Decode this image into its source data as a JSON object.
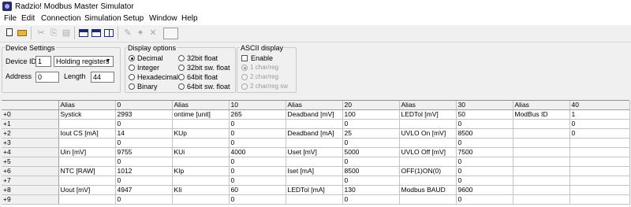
{
  "window": {
    "title": "Radzio! Modbus Master Simulator",
    "icon": "app-icon"
  },
  "menu": [
    "File",
    "Edit",
    "Connection",
    "Simulation",
    "Setup",
    "Window",
    "Help"
  ],
  "toolbar": {
    "icons": [
      "new-icon",
      "open-icon",
      "cut-icon",
      "copy-icon",
      "paste-icon",
      "cascade-icon",
      "tile-horizontal-icon",
      "tile-vertical-icon",
      "connect-icon",
      "disconnect-icon",
      "close-icon"
    ]
  },
  "device_settings": {
    "title": "Device Settings",
    "device_id_label": "Device ID",
    "device_id_value": "1",
    "register_type": "Holding registers",
    "address_label": "Address",
    "address_value": "0",
    "length_label": "Length",
    "length_value": "44"
  },
  "display_options": {
    "title": "Display options",
    "col1": [
      "Decimal",
      "Integer",
      "Hexadecimal",
      "Binary"
    ],
    "col2": [
      "32bit float",
      "32bit sw. float",
      "64bit float",
      "64bit sw. float"
    ],
    "selected": "Decimal"
  },
  "ascii_display": {
    "title": "ASCII display",
    "enable_label": "Enable",
    "enabled": false,
    "options": [
      "1 char/reg",
      "2 char/reg",
      "2 char/reg sw"
    ],
    "selected": "1 char/reg"
  },
  "grid": {
    "headers": [
      "",
      "Alias",
      "0",
      "Alias",
      "10",
      "Alias",
      "20",
      "Alias",
      "30",
      "Alias",
      "40"
    ],
    "rows": [
      [
        "+0",
        "Systick",
        "2993",
        "ontime [unit]",
        "265",
        "Deadband [mV]",
        "100",
        "LEDTol [mV]",
        "50",
        "ModBus ID",
        "1"
      ],
      [
        "+1",
        "",
        "0",
        "",
        "0",
        "",
        "0",
        "",
        "0",
        "",
        "0"
      ],
      [
        "+2",
        "Iout CS [mA]",
        "14",
        "KUp",
        "0",
        "Deadband [mA]",
        "25",
        "UVLO On [mV]",
        "8500",
        "",
        "0"
      ],
      [
        "+3",
        "",
        "0",
        "",
        "0",
        "",
        "0",
        "",
        "0",
        "",
        ""
      ],
      [
        "+4",
        "Uin [mV]",
        "9755",
        "KUi",
        "4000",
        "Uset [mV]",
        "5000",
        "UVLO Off [mV]",
        "7500",
        "",
        ""
      ],
      [
        "+5",
        "",
        "0",
        "",
        "0",
        "",
        "0",
        "",
        "0",
        "",
        ""
      ],
      [
        "+6",
        "NTC [RAW]",
        "1012",
        "KIp",
        "0",
        "Iset [mA]",
        "8500",
        "OFF(1)ON(0)",
        "0",
        "",
        ""
      ],
      [
        "+7",
        "",
        "0",
        "",
        "0",
        "",
        "0",
        "",
        "0",
        "",
        ""
      ],
      [
        "+8",
        "Uout [mV]",
        "4947",
        "KIi",
        "60",
        "LEDTol [mA]",
        "130",
        "Modbus BAUD",
        "9600",
        "",
        ""
      ],
      [
        "+9",
        "",
        "0",
        "",
        "0",
        "",
        "0",
        "",
        "0",
        "",
        ""
      ]
    ]
  }
}
